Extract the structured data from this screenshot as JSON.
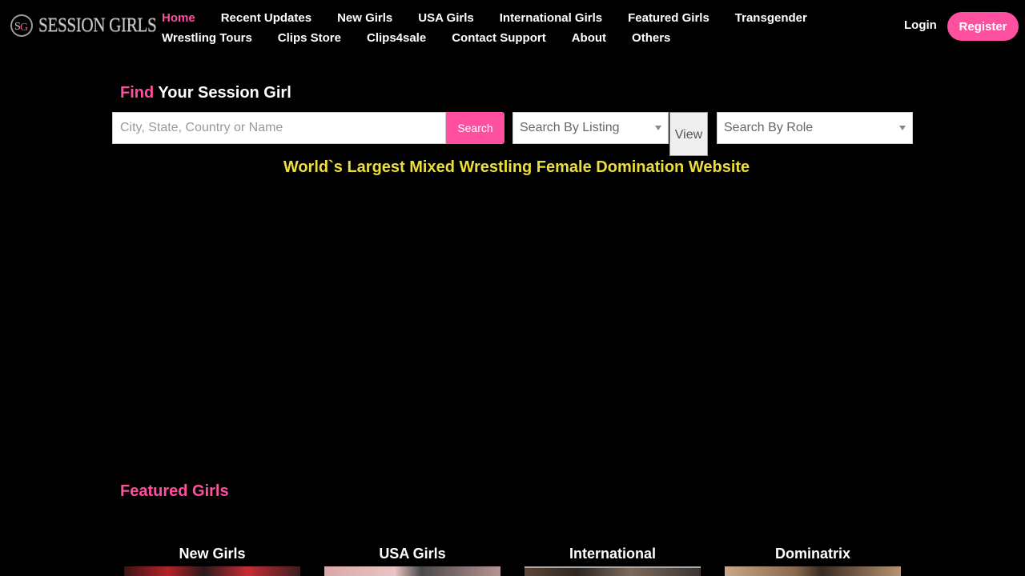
{
  "site": {
    "logo_text": "SESSION GIRLS",
    "logo_monogram": "SG",
    "brand_color": "#ff4f9f",
    "tagline_color": "#ecdf3c"
  },
  "nav": {
    "row1": [
      "Home",
      "Recent Updates",
      "New Girls",
      "USA Girls",
      "International Girls",
      "Featured Girls",
      "Transgender"
    ],
    "row2": [
      "Wrestling Tours",
      "Clips Store",
      "Clips4sale",
      "Contact Support",
      "About",
      "Others"
    ],
    "active": "Home"
  },
  "auth": {
    "login_label": "Login",
    "register_label": "Register"
  },
  "search": {
    "heading_accent": "Find",
    "heading_rest": "Your Session Girl",
    "input_placeholder": "City, State, Country or Name",
    "search_button": "Search",
    "listing_select": "Search By Listing",
    "view_button": "View",
    "role_select": "Search By Role"
  },
  "tagline": "World`s Largest Mixed Wrestling Female Domination Website",
  "featured": {
    "heading": "Featured Girls",
    "categories": [
      "New Girls",
      "USA Girls",
      "International",
      "Dominatrix"
    ]
  }
}
